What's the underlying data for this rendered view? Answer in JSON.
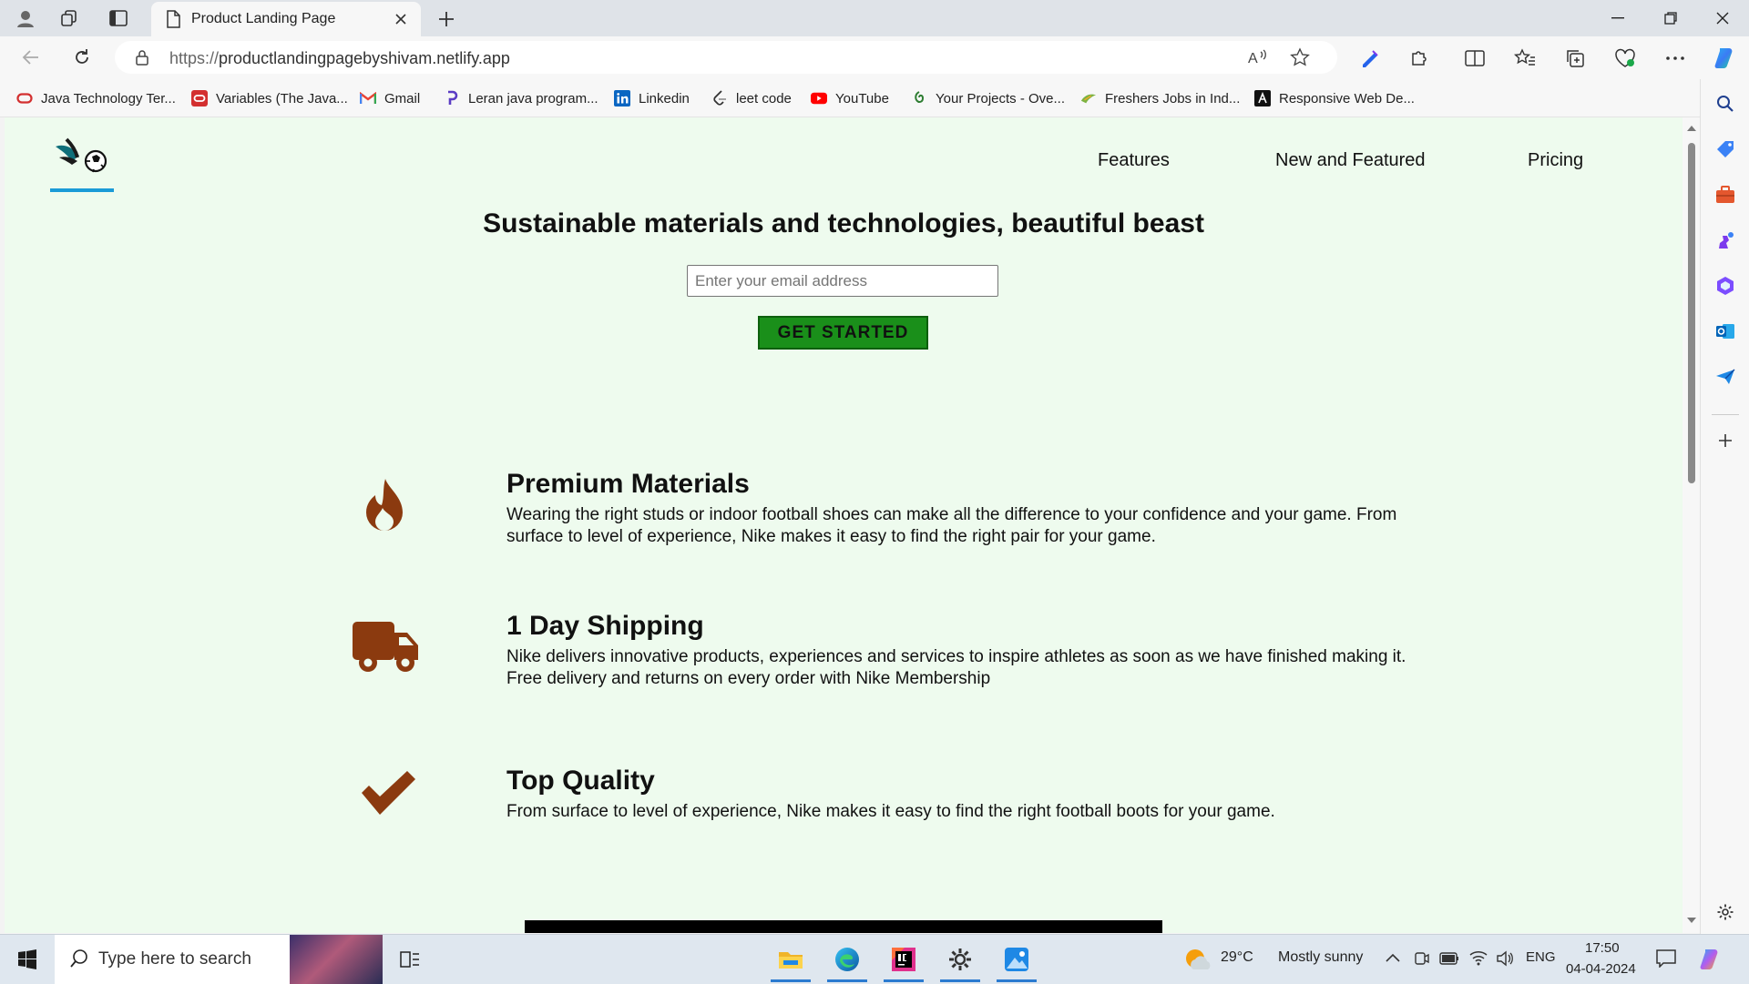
{
  "browser": {
    "tab_title": "Product Landing Page",
    "url_protocol": "https://",
    "url_host": "productlandingpagebyshivam.netlify.app",
    "bookmarks": [
      {
        "label": "Java Technology Ter...",
        "icon": "oracle-icon",
        "color": "#d32f2f"
      },
      {
        "label": "Variables (The Java...",
        "icon": "oracle-box-icon",
        "color": "#d32f2f"
      },
      {
        "label": "Gmail",
        "icon": "gmail-icon",
        "color": "#ea4335"
      },
      {
        "label": "Leran java program...",
        "icon": "program-icon",
        "color": "#5b3cc4"
      },
      {
        "label": "Linkedin",
        "icon": "linkedin-icon",
        "color": "#0a66c2"
      },
      {
        "label": "leet code",
        "icon": "leetcode-icon",
        "color": "#333333"
      },
      {
        "label": "YouTube",
        "icon": "youtube-icon",
        "color": "#ff0000"
      },
      {
        "label": "Your Projects - Ove...",
        "icon": "projects-icon",
        "color": "#2e7d32"
      },
      {
        "label": "Freshers Jobs in Ind...",
        "icon": "jobs-icon",
        "color": "#7cb342"
      },
      {
        "label": "Responsive Web De...",
        "icon": "responsive-icon",
        "color": "#111111"
      }
    ]
  },
  "page": {
    "nav": [
      "Features",
      "New and Featured",
      "Pricing"
    ],
    "headline": "Sustainable materials and technologies, beautiful beast",
    "email_placeholder": "Enter your email address",
    "cta_label": "GET STARTED",
    "accent_color": "#8b3a0f",
    "features": [
      {
        "icon": "fire-icon",
        "title": "Premium Materials",
        "body": "Wearing the right studs or indoor football shoes can make all the difference to your confidence and your game. From surface to level of experience, Nike makes it easy to find the right pair for your game."
      },
      {
        "icon": "truck-icon",
        "title": "1 Day Shipping",
        "body": "Nike delivers innovative products, experiences and services to inspire athletes as soon as we have finished making it. Free delivery and returns on every order with Nike Membership"
      },
      {
        "icon": "check-icon",
        "title": "Top Quality",
        "body": "From surface to level of experience, Nike makes it easy to find the right football boots for your game."
      }
    ]
  },
  "taskbar": {
    "search_placeholder": "Type here to search",
    "weather_temp": "29°C",
    "weather_text": "Mostly sunny",
    "language": "ENG",
    "time": "17:50",
    "date": "04-04-2024"
  }
}
